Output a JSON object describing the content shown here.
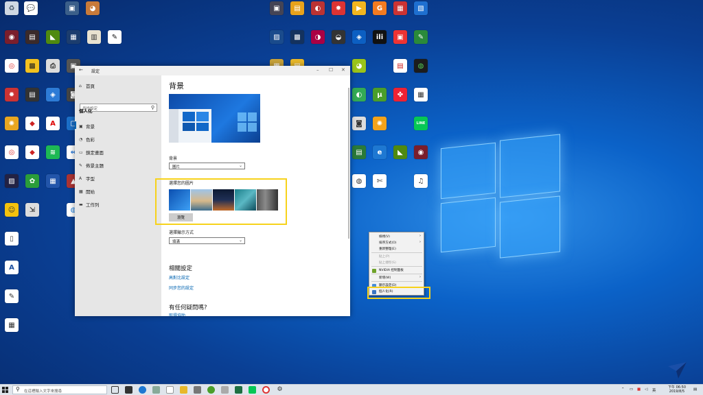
{
  "window": {
    "title": "設定",
    "sidebar": {
      "home": "首頁",
      "search_placeholder": "尋找設定",
      "section": "個人化",
      "items": [
        {
          "label": "背景",
          "icon": "picture-icon"
        },
        {
          "label": "色彩",
          "icon": "palette-icon"
        },
        {
          "label": "鎖定畫面",
          "icon": "lock-screen-icon"
        },
        {
          "label": "佈景主題",
          "icon": "theme-icon"
        },
        {
          "label": "字型",
          "icon": "font-icon"
        },
        {
          "label": "開始",
          "icon": "start-icon"
        },
        {
          "label": "工作列",
          "icon": "taskbar-icon"
        }
      ]
    },
    "main": {
      "title": "背景",
      "background_label": "背景",
      "background_value": "圖片",
      "choose_picture_label": "選擇您的圖片",
      "browse_button": "瀏覽",
      "fit_label": "選擇顯示方式",
      "fit_value": "填滿",
      "related_heading": "相關設定",
      "related_links": [
        "高對比設定",
        "同步您的設定"
      ],
      "question_heading": "有任何疑問嗎?",
      "question_link": "取得協助"
    }
  },
  "context_menu": {
    "items": [
      {
        "label": "檢視(V)",
        "submenu": true,
        "disabled": false
      },
      {
        "label": "排序方式(O)",
        "submenu": true,
        "disabled": false
      },
      {
        "label": "重新整理(E)",
        "submenu": false,
        "disabled": false
      },
      {
        "label": "貼上(P)",
        "submenu": false,
        "disabled": true
      },
      {
        "label": "貼上捷徑(S)",
        "submenu": false,
        "disabled": true
      },
      {
        "label": "NVIDIA 控制面板",
        "submenu": false,
        "disabled": false
      },
      {
        "label": "新增(W)",
        "submenu": true,
        "disabled": false
      },
      {
        "label": "顯示設定(D)",
        "submenu": false,
        "disabled": false
      },
      {
        "label": "個人化(R)",
        "submenu": false,
        "disabled": false
      }
    ]
  },
  "taskbar": {
    "search_placeholder": "在這裡輸入文字來搜尋",
    "language": "英",
    "time": "下午 06:50",
    "date": "2019/8/5"
  },
  "colors": {
    "accent": "#0063b1",
    "highlight": "#f7d21a",
    "desktop": "#0b62c8"
  }
}
